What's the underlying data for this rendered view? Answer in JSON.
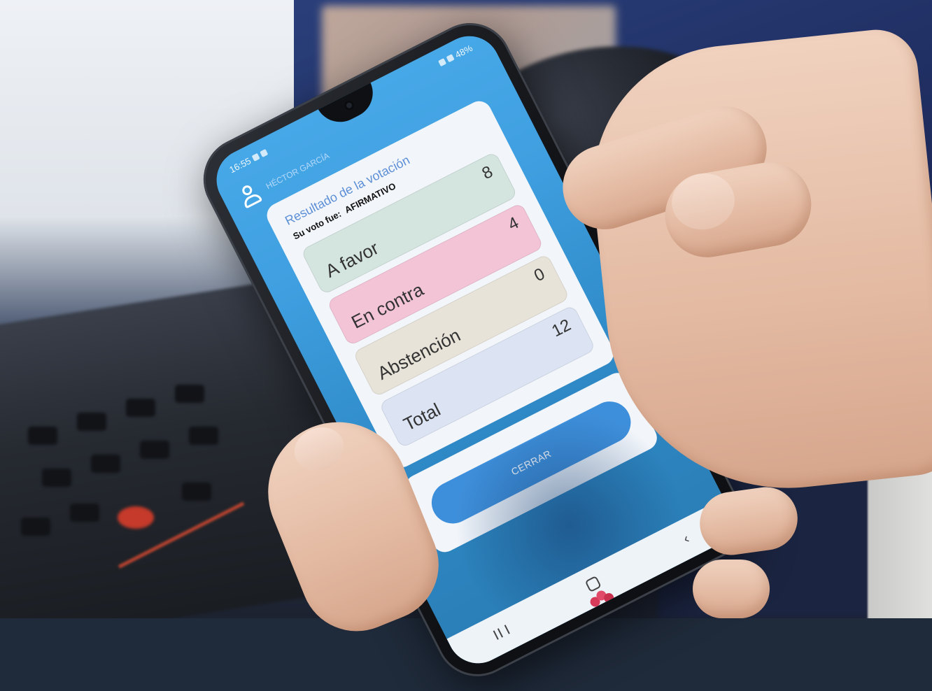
{
  "status_bar": {
    "time": "16:55",
    "battery": "48%"
  },
  "user": {
    "name": "HÉCTOR GARCÍA"
  },
  "result": {
    "title": "Resultado de la votación",
    "vote_label": "Su voto fue:",
    "vote_value": "AFIRMATIVO",
    "rows": [
      {
        "label": "A favor",
        "value": "8",
        "color": "#d4e4de"
      },
      {
        "label": "En contra",
        "value": "4",
        "color": "#f3c4d6"
      },
      {
        "label": "Abstención",
        "value": "0",
        "color": "#e8e3d8"
      },
      {
        "label": "Total",
        "value": "12",
        "color": "#dce4f4"
      }
    ]
  },
  "actions": {
    "close_label": "CERRAR"
  },
  "nav": {
    "back_symbol": "‹"
  }
}
